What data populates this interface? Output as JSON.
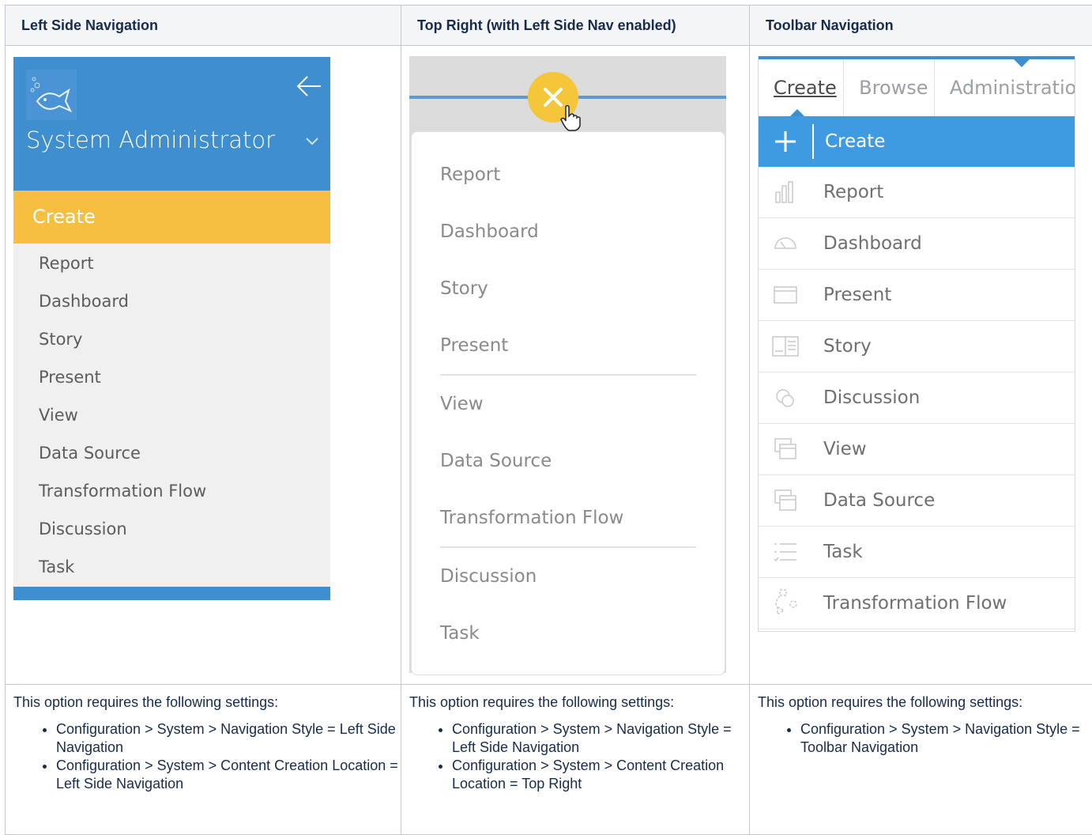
{
  "headers": [
    "Left Side Navigation",
    "Top Right (with Left Side Nav enabled)",
    "Toolbar Navigation"
  ],
  "left_nav": {
    "user": "System Administrator",
    "create": "Create",
    "items": [
      "Report",
      "Dashboard",
      "Story",
      "Present",
      "View",
      "Data Source",
      "Transformation Flow",
      "Discussion",
      "Task"
    ]
  },
  "top_right": {
    "group1": [
      "Report",
      "Dashboard",
      "Story",
      "Present"
    ],
    "group2": [
      "View",
      "Data Source",
      "Transformation Flow"
    ],
    "group3": [
      "Discussion",
      "Task"
    ]
  },
  "toolbar": {
    "tabs": [
      "Create",
      "Browse",
      "Administratio"
    ],
    "create": "Create",
    "items": [
      {
        "label": "Report",
        "icon": "bar-chart-icon"
      },
      {
        "label": "Dashboard",
        "icon": "gauge-icon"
      },
      {
        "label": "Present",
        "icon": "window-icon"
      },
      {
        "label": "Story",
        "icon": "book-icon"
      },
      {
        "label": "Discussion",
        "icon": "chat-icon"
      },
      {
        "label": "View",
        "icon": "stacked-windows-icon"
      },
      {
        "label": "Data Source",
        "icon": "stacked-windows-icon"
      },
      {
        "label": "Task",
        "icon": "checklist-icon"
      },
      {
        "label": "Transformation Flow",
        "icon": "flow-icon"
      }
    ]
  },
  "notes": {
    "intro": "This option requires the following settings:",
    "left": [
      "Configuration > System > Navigation Style = Left Side Navigation",
      "Configuration > System > Content Creation Location = Left Side Navigation"
    ],
    "middle": [
      "Configuration > System > Navigation Style = Left Side Navigation",
      "Configuration > System > Content Creation Location = Top Right"
    ],
    "right": [
      "Configuration > System > Navigation Style = Toolbar Navigation"
    ]
  },
  "colors": {
    "blue": "#3e8ed0",
    "yellow": "#f7bf3f",
    "toolbar_blue": "#3e9be2"
  }
}
